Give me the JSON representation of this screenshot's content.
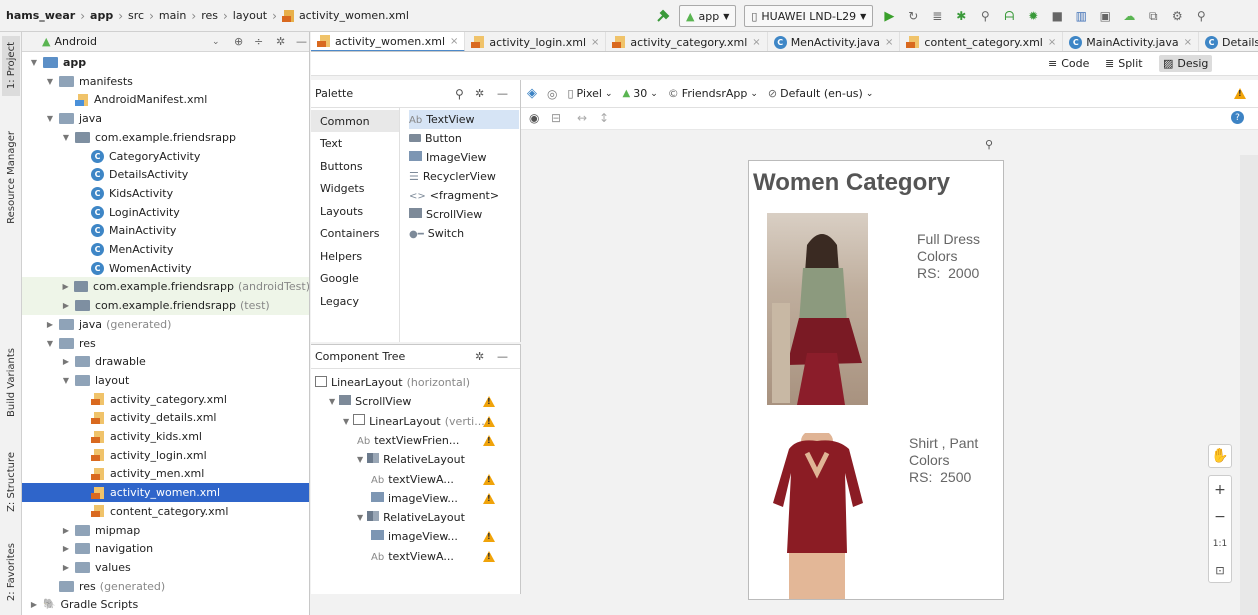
{
  "navbar": {
    "crumbs": [
      "hams_wear",
      "app",
      "src",
      "main",
      "res",
      "layout",
      "activity_women.xml"
    ],
    "run_config": "app",
    "device": "HUAWEI LND-L29"
  },
  "side_tabs": [
    "1: Project",
    "Resource Manager",
    "Build Variants",
    "Z: Structure",
    "2: Favorites"
  ],
  "project": {
    "view": "Android",
    "tree": [
      {
        "label": "app",
        "indent": 0,
        "kind": "module",
        "arrow": "down",
        "bold": true
      },
      {
        "label": "manifests",
        "indent": 1,
        "kind": "folder",
        "arrow": "down"
      },
      {
        "label": "AndroidManifest.xml",
        "indent": 2,
        "kind": "manifest"
      },
      {
        "label": "java",
        "indent": 1,
        "kind": "folder",
        "arrow": "down"
      },
      {
        "label": "com.example.friendsrapp",
        "indent": 2,
        "kind": "pkg",
        "arrow": "down"
      },
      {
        "label": "CategoryActivity",
        "indent": 3,
        "kind": "class"
      },
      {
        "label": "DetailsActivity",
        "indent": 3,
        "kind": "class"
      },
      {
        "label": "KidsActivity",
        "indent": 3,
        "kind": "class"
      },
      {
        "label": "LoginActivity",
        "indent": 3,
        "kind": "class"
      },
      {
        "label": "MainActivity",
        "indent": 3,
        "kind": "class"
      },
      {
        "label": "MenActivity",
        "indent": 3,
        "kind": "class"
      },
      {
        "label": "WomenActivity",
        "indent": 3,
        "kind": "class"
      },
      {
        "label": "com.example.friendsrapp",
        "suffix": "(androidTest)",
        "indent": 2,
        "kind": "pkg",
        "arrow": "right",
        "hl": true
      },
      {
        "label": "com.example.friendsrapp",
        "suffix": "(test)",
        "indent": 2,
        "kind": "pkg",
        "arrow": "right",
        "hl": true
      },
      {
        "label": "java",
        "suffix": "(generated)",
        "indent": 1,
        "kind": "folder",
        "arrow": "right"
      },
      {
        "label": "res",
        "indent": 1,
        "kind": "folder",
        "arrow": "down"
      },
      {
        "label": "drawable",
        "indent": 2,
        "kind": "folder",
        "arrow": "right"
      },
      {
        "label": "layout",
        "indent": 2,
        "kind": "folder",
        "arrow": "down"
      },
      {
        "label": "activity_category.xml",
        "indent": 3,
        "kind": "xml"
      },
      {
        "label": "activity_details.xml",
        "indent": 3,
        "kind": "xml"
      },
      {
        "label": "activity_kids.xml",
        "indent": 3,
        "kind": "xml"
      },
      {
        "label": "activity_login.xml",
        "indent": 3,
        "kind": "xml"
      },
      {
        "label": "activity_men.xml",
        "indent": 3,
        "kind": "xml"
      },
      {
        "label": "activity_women.xml",
        "indent": 3,
        "kind": "xml",
        "selected": true
      },
      {
        "label": "content_category.xml",
        "indent": 3,
        "kind": "xml"
      },
      {
        "label": "mipmap",
        "indent": 2,
        "kind": "folder",
        "arrow": "right"
      },
      {
        "label": "navigation",
        "indent": 2,
        "kind": "folder",
        "arrow": "right"
      },
      {
        "label": "values",
        "indent": 2,
        "kind": "folder",
        "arrow": "right"
      },
      {
        "label": "res",
        "suffix": "(generated)",
        "indent": 1,
        "kind": "folder"
      },
      {
        "label": "Gradle Scripts",
        "indent": 0,
        "kind": "gradle",
        "arrow": "right"
      }
    ]
  },
  "tabs": [
    "activity_women.xml",
    "activity_login.xml",
    "activity_category.xml",
    "MenActivity.java",
    "content_category.xml",
    "MainActivity.java",
    "DetailsActiv"
  ],
  "modes": {
    "code": "Code",
    "split": "Split",
    "design": "Desig"
  },
  "palette": {
    "title": "Palette",
    "categories": [
      "Common",
      "Text",
      "Buttons",
      "Widgets",
      "Layouts",
      "Containers",
      "Helpers",
      "Google",
      "Legacy"
    ],
    "items": [
      {
        "icon": "Ab",
        "label": "TextView"
      },
      {
        "icon": "btn",
        "label": "Button"
      },
      {
        "icon": "img",
        "label": "ImageView"
      },
      {
        "icon": "list",
        "label": "RecyclerView"
      },
      {
        "icon": "frag",
        "label": "<fragment>"
      },
      {
        "icon": "scroll",
        "label": "ScrollView"
      },
      {
        "icon": "switch",
        "label": "Switch"
      }
    ]
  },
  "component_tree": {
    "title": "Component Tree",
    "rows": [
      {
        "label": "LinearLayout",
        "suffix": "(horizontal)",
        "indent": 0,
        "icon": "linear"
      },
      {
        "label": "ScrollView",
        "indent": 1,
        "icon": "scroll",
        "arrow": "down",
        "warn": true
      },
      {
        "label": "LinearLayout",
        "suffix": "(verti...",
        "indent": 2,
        "icon": "linear",
        "arrow": "down",
        "warn": true
      },
      {
        "label": "textViewFrien...",
        "indent": 3,
        "icon": "Ab",
        "warn": true
      },
      {
        "label": "RelativeLayout",
        "indent": 3,
        "icon": "rel",
        "arrow": "down"
      },
      {
        "label": "textViewA...",
        "indent": 4,
        "icon": "Ab",
        "warn": true
      },
      {
        "label": "imageView...",
        "indent": 4,
        "icon": "img",
        "warn": true
      },
      {
        "label": "RelativeLayout",
        "indent": 3,
        "icon": "rel",
        "arrow": "down"
      },
      {
        "label": "imageView...",
        "indent": 4,
        "icon": "img",
        "warn": true
      },
      {
        "label": "textViewA...",
        "indent": 4,
        "icon": "Ab",
        "warn": true
      }
    ]
  },
  "design_toolbar": {
    "device": "Pixel",
    "api": "30",
    "theme": "FriendsrApp",
    "locale": "Default (en-us)"
  },
  "preview": {
    "title": "Women Category",
    "products": [
      {
        "line1": "Full Dress",
        "line2": "Colors",
        "price": "RS:  2000"
      },
      {
        "line1": "Shirt , Pant",
        "line2": "Colors",
        "price": "RS:  2500"
      }
    ]
  },
  "zoom": {
    "plus": "+",
    "minus": "−",
    "one": "1:1"
  }
}
